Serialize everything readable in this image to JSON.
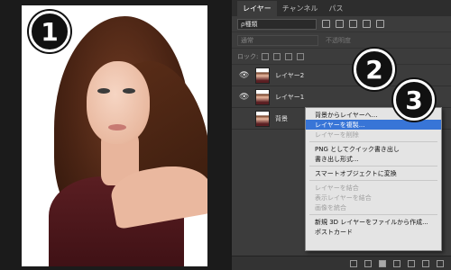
{
  "badges": [
    "1",
    "2",
    "3"
  ],
  "panel": {
    "tabs": [
      "レイヤー",
      "チャンネル",
      "パス"
    ],
    "filter_label": "ρ種類",
    "blend_mode": "通常",
    "opacity_label": "不透明度",
    "lock_label": "ロック:",
    "layers": [
      {
        "name": "レイヤー2"
      },
      {
        "name": "レイヤー1"
      },
      {
        "name": "背景"
      }
    ]
  },
  "context_menu": {
    "items": [
      {
        "label": "背景からレイヤーへ...",
        "state": "enabled"
      },
      {
        "label": "レイヤーを複製...",
        "state": "highlight"
      },
      {
        "label": "レイヤーを削除",
        "state": "disabled"
      },
      {
        "label": "PNG としてクイック書き出し",
        "state": "enabled"
      },
      {
        "label": "書き出し形式...",
        "state": "enabled"
      },
      {
        "label": "スマートオブジェクトに変換",
        "state": "enabled"
      },
      {
        "label": "レイヤーを結合",
        "state": "disabled"
      },
      {
        "label": "表示レイヤーを結合",
        "state": "disabled"
      },
      {
        "label": "画像を統合",
        "state": "disabled"
      },
      {
        "label": "新規 3D レイヤーをファイルから作成...",
        "state": "enabled"
      },
      {
        "label": "ポストカード",
        "state": "enabled"
      }
    ]
  },
  "colors": {
    "panel_bg": "#3c3c3c",
    "menu_bg": "#e4e4e4",
    "highlight": "#3875d7"
  }
}
